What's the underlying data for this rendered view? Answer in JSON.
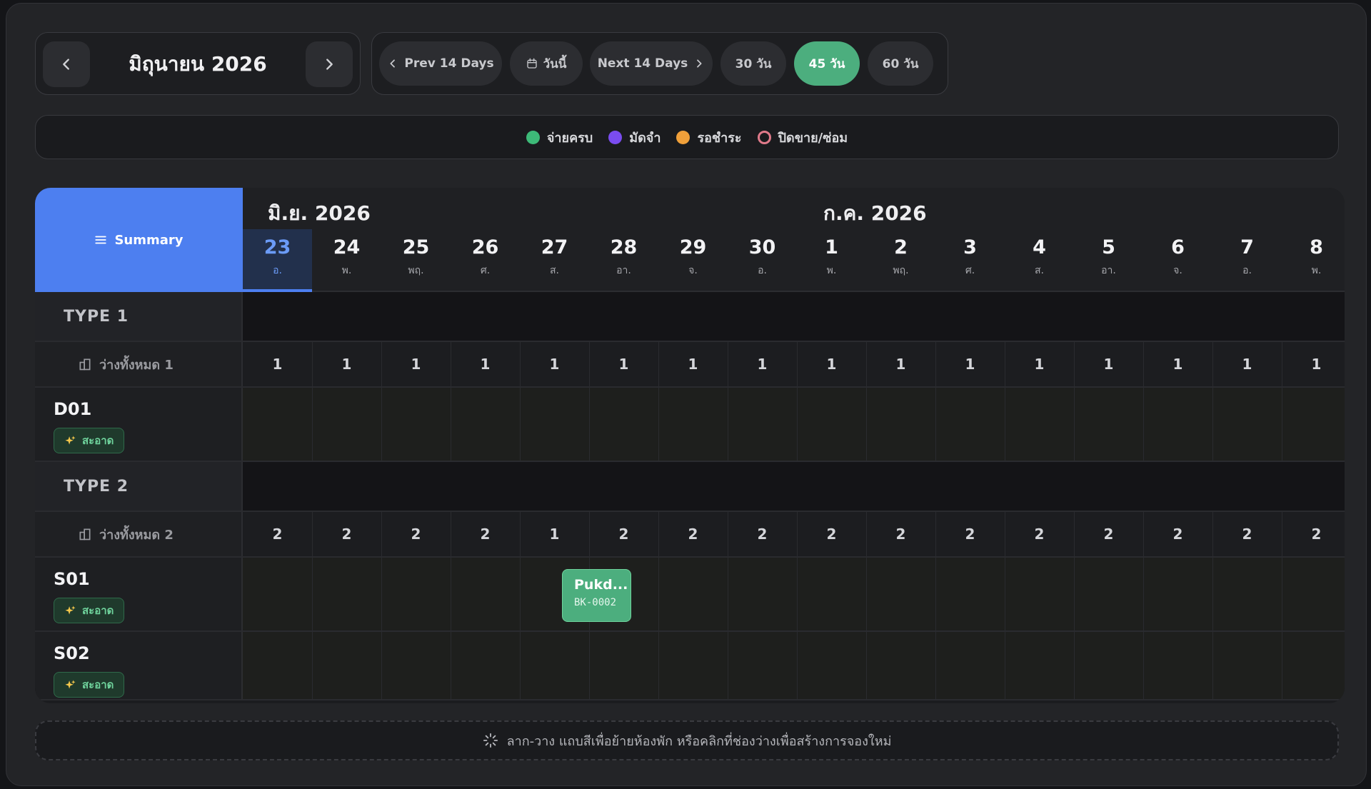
{
  "toolbar": {
    "month_title": "มิถุนายน 2026",
    "prev_label": "Prev 14 Days",
    "today_label": "วันนี้",
    "next_label": "Next 14 Days",
    "ranges": [
      "30 วัน",
      "45 วัน",
      "60 วัน"
    ],
    "active_range": "45 วัน",
    "accent_color": "#4cae7e"
  },
  "legend": [
    {
      "label": "จ่ายครบ",
      "color": "#3dba78",
      "style": "filled"
    },
    {
      "label": "มัดจำ",
      "color": "#7a4cf0",
      "style": "filled"
    },
    {
      "label": "รอชำระ",
      "color": "#f0a03a",
      "style": "filled"
    },
    {
      "label": "ปิดขาย/ซ่อม",
      "color": "#e07a8a",
      "style": "ring"
    }
  ],
  "grid": {
    "summary_label": "Summary",
    "month_captions": [
      "มิ.ย. 2026",
      "ก.ค. 2026"
    ],
    "days": [
      {
        "num": "23",
        "wd": "อ.",
        "today": true
      },
      {
        "num": "24",
        "wd": "พ."
      },
      {
        "num": "25",
        "wd": "พฤ."
      },
      {
        "num": "26",
        "wd": "ศ."
      },
      {
        "num": "27",
        "wd": "ส."
      },
      {
        "num": "28",
        "wd": "อา."
      },
      {
        "num": "29",
        "wd": "จ."
      },
      {
        "num": "30",
        "wd": "อ."
      },
      {
        "num": "1",
        "wd": "พ."
      },
      {
        "num": "2",
        "wd": "พฤ."
      },
      {
        "num": "3",
        "wd": "ศ."
      },
      {
        "num": "4",
        "wd": "ส."
      },
      {
        "num": "5",
        "wd": "อา."
      },
      {
        "num": "6",
        "wd": "จ."
      },
      {
        "num": "7",
        "wd": "อ."
      },
      {
        "num": "8",
        "wd": "พ."
      }
    ],
    "types": [
      {
        "name": "TYPE 1",
        "avail_label": "ว่างทั้งหมด 1",
        "avail": [
          1,
          1,
          1,
          1,
          1,
          1,
          1,
          1,
          1,
          1,
          1,
          1,
          1,
          1,
          1,
          1
        ],
        "rooms": [
          {
            "name": "D01",
            "status": "สะอาด"
          }
        ]
      },
      {
        "name": "TYPE 2",
        "avail_label": "ว่างทั้งหมด 2",
        "avail": [
          2,
          2,
          2,
          2,
          1,
          2,
          2,
          2,
          2,
          2,
          2,
          2,
          2,
          2,
          2,
          2
        ],
        "rooms": [
          {
            "name": "S01",
            "status": "สะอาด"
          },
          {
            "name": "S02",
            "status": "สะอาด"
          }
        ]
      }
    ],
    "booking": {
      "guest": "Pukd...",
      "id": "BK-0002",
      "color": "#4cae7e"
    }
  },
  "hint": "ลาก-วาง แถบสีเพื่อย้ายห้องพัก หรือคลิกที่ช่องว่างเพื่อสร้างการจองใหม่"
}
